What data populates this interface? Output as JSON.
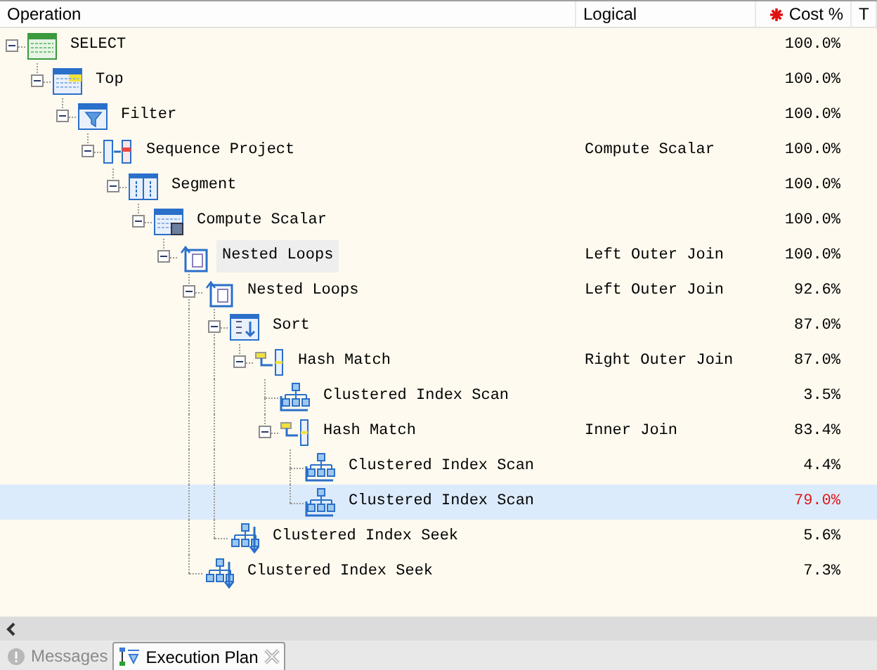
{
  "columns": [
    {
      "label": "Operation",
      "kind": "text"
    },
    {
      "label": "Logical",
      "kind": "text"
    },
    {
      "label": "Cost %",
      "kind": "cost"
    },
    {
      "label": "T",
      "kind": "text"
    }
  ],
  "plan": [
    {
      "operation": "SELECT",
      "kind": "select",
      "cost": "100.0%",
      "expanded": true,
      "selected": false,
      "focused": false,
      "hot": false,
      "children": [
        {
          "operation": "Top",
          "kind": "top",
          "cost": "100.0%",
          "expanded": true,
          "selected": false,
          "focused": false,
          "hot": false,
          "children": [
            {
              "operation": "Filter",
              "kind": "filter",
              "cost": "100.0%",
              "expanded": true,
              "selected": false,
              "focused": false,
              "hot": false,
              "children": [
                {
                  "operation": "Sequence Project",
                  "kind": "sequence_project",
                  "logical": "Compute Scalar",
                  "cost": "100.0%",
                  "expanded": true,
                  "selected": false,
                  "focused": false,
                  "hot": false,
                  "children": [
                    {
                      "operation": "Segment",
                      "kind": "segment",
                      "cost": "100.0%",
                      "expanded": true,
                      "selected": false,
                      "focused": false,
                      "hot": false,
                      "children": [
                        {
                          "operation": "Compute Scalar",
                          "kind": "compute_scalar",
                          "cost": "100.0%",
                          "expanded": true,
                          "selected": false,
                          "focused": false,
                          "hot": false,
                          "children": [
                            {
                              "operation": "Nested Loops",
                              "kind": "nested_loops",
                              "logical": "Left Outer Join",
                              "cost": "100.0%",
                              "expanded": true,
                              "selected": false,
                              "focused": true,
                              "hot": false,
                              "children": [
                                {
                                  "operation": "Nested Loops",
                                  "kind": "nested_loops",
                                  "logical": "Left Outer Join",
                                  "cost": "92.6%",
                                  "expanded": true,
                                  "selected": false,
                                  "focused": false,
                                  "hot": false,
                                  "children": [
                                    {
                                      "operation": "Sort",
                                      "kind": "sort",
                                      "cost": "87.0%",
                                      "expanded": true,
                                      "selected": false,
                                      "focused": false,
                                      "hot": false,
                                      "children": [
                                        {
                                          "operation": "Hash Match",
                                          "kind": "hash_match",
                                          "logical": "Right Outer Join",
                                          "cost": "87.0%",
                                          "expanded": true,
                                          "selected": false,
                                          "focused": false,
                                          "hot": false,
                                          "children": [
                                            {
                                              "operation": "Clustered Index Scan",
                                              "kind": "index_scan",
                                              "cost": "3.5%",
                                              "selected": false,
                                              "focused": false,
                                              "hot": false
                                            },
                                            {
                                              "operation": "Hash Match",
                                              "kind": "hash_match",
                                              "logical": "Inner Join",
                                              "cost": "83.4%",
                                              "expanded": true,
                                              "selected": false,
                                              "focused": false,
                                              "hot": false,
                                              "children": [
                                                {
                                                  "operation": "Clustered Index Scan",
                                                  "kind": "index_scan",
                                                  "cost": "4.4%",
                                                  "selected": false,
                                                  "focused": false,
                                                  "hot": false
                                                },
                                                {
                                                  "operation": "Clustered Index Scan",
                                                  "kind": "index_scan",
                                                  "cost": "79.0%",
                                                  "selected": true,
                                                  "focused": false,
                                                  "hot": true
                                                }
                                              ]
                                            }
                                          ]
                                        }
                                      ]
                                    },
                                    {
                                      "operation": "Clustered Index Seek",
                                      "kind": "index_seek",
                                      "cost": "5.6%",
                                      "selected": false,
                                      "focused": false,
                                      "hot": false
                                    }
                                  ]
                                },
                                {
                                  "operation": "Clustered Index Seek",
                                  "kind": "index_seek",
                                  "cost": "7.3%",
                                  "selected": false,
                                  "focused": false,
                                  "hot": false
                                }
                              ]
                            }
                          ]
                        }
                      ]
                    }
                  ]
                }
              ]
            }
          ]
        }
      ]
    }
  ],
  "tabs": [
    {
      "label": "Messages",
      "kind": "messages",
      "selected": false
    },
    {
      "label": "Execution Plan",
      "kind": "plan",
      "selected": true
    }
  ]
}
